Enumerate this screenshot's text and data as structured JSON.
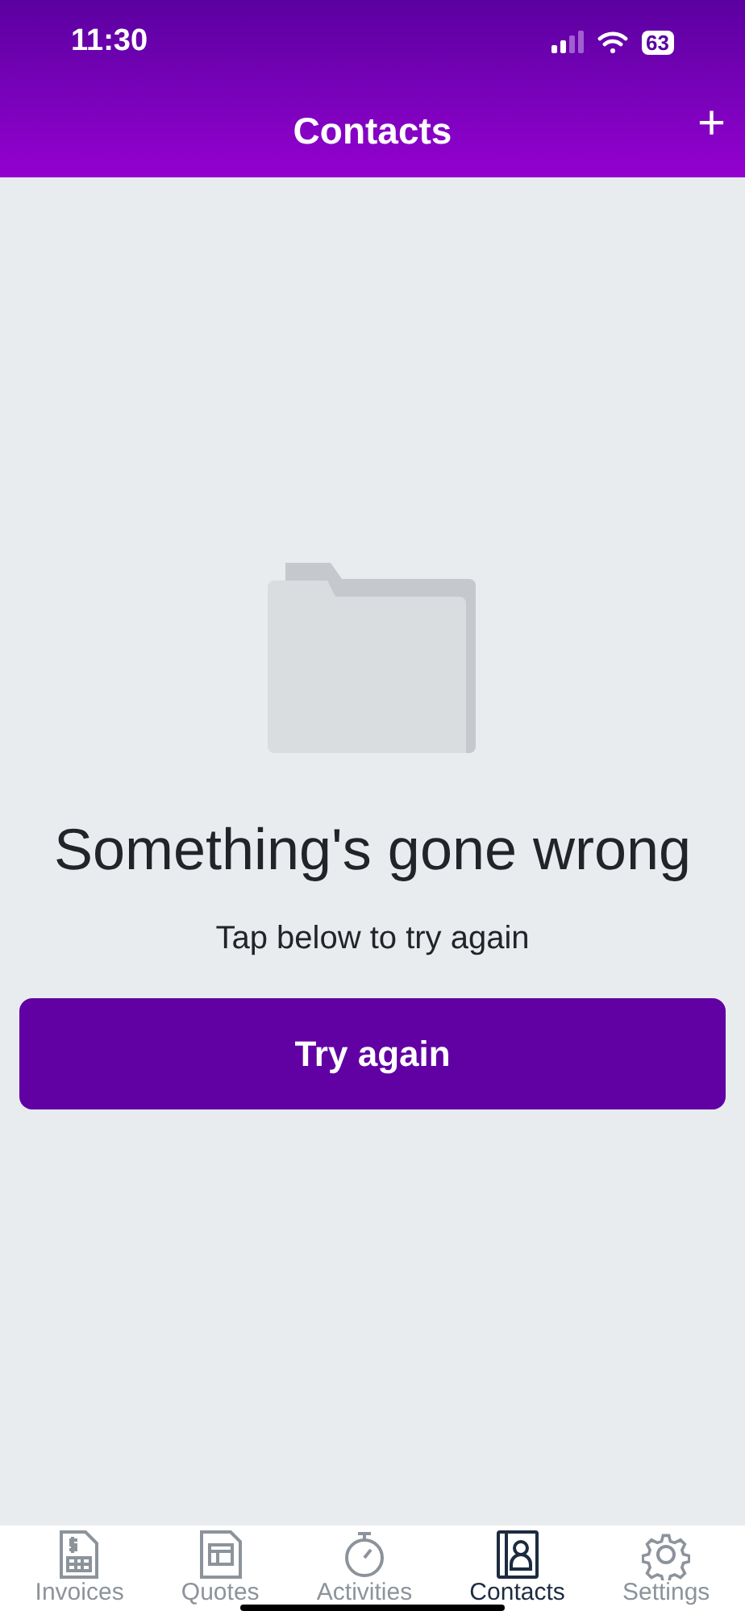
{
  "status_bar": {
    "time": "11:30",
    "battery": "63"
  },
  "header": {
    "title": "Contacts",
    "add_label": "+"
  },
  "error": {
    "title": "Something's gone wrong",
    "message": "Tap below to try again",
    "button": "Try again"
  },
  "tabs": [
    {
      "label": "Invoices",
      "selected": false
    },
    {
      "label": "Quotes",
      "selected": false
    },
    {
      "label": "Activities",
      "selected": false
    },
    {
      "label": "Contacts",
      "selected": true
    },
    {
      "label": "Settings",
      "selected": false
    }
  ]
}
